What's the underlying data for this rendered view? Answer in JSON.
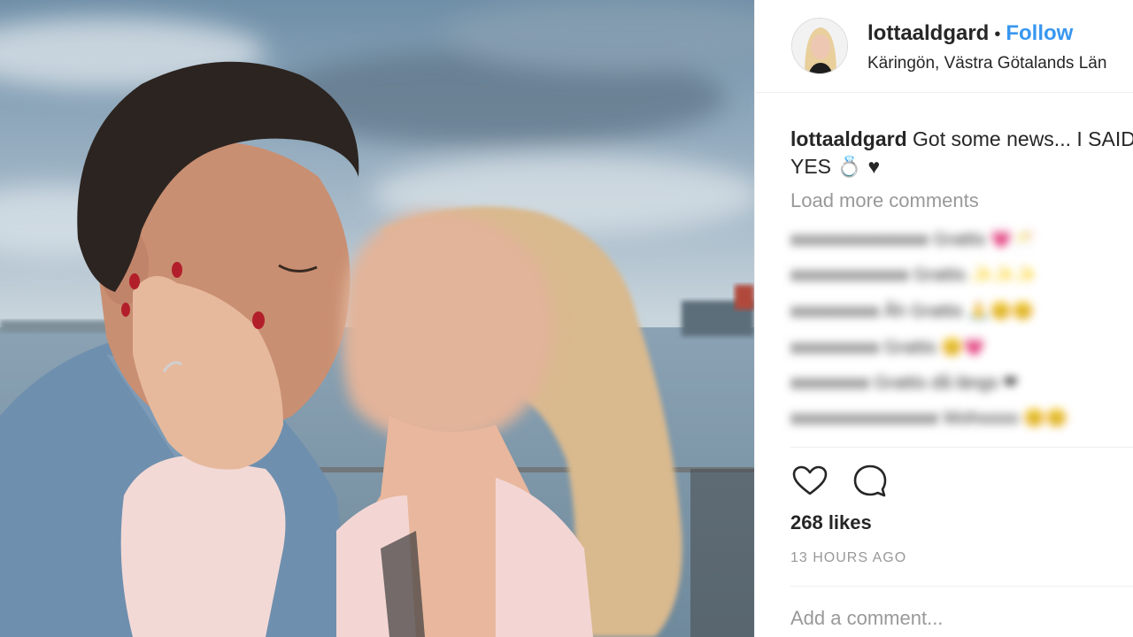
{
  "post": {
    "username": "lottaaldgard",
    "dot": "•",
    "follow_label": "Follow",
    "location": "Käringön, Västra Götalands Län",
    "caption_username": "lottaaldgard",
    "caption_text_line1": "Got some news... I SAID",
    "caption_text_line2": "YES 💍 ♥",
    "load_more_label": "Load more comments",
    "likes_label": "268 likes",
    "timestamp": "13 HOURS AGO",
    "add_comment_placeholder": "Add a comment..."
  },
  "blurred_comments": [
    {
      "user": "xxxxxxxxxxxxxx",
      "text": "Grattis 💗🥂"
    },
    {
      "user": "xxxxxxxxxxxx",
      "text": "Grattis ✨✨✨"
    },
    {
      "user": "xxxxxxxxx",
      "text": "Åh Grattis 🙏😊😊"
    },
    {
      "user": "xxxxxxxxx",
      "text": "Grattis 😊💗"
    },
    {
      "user": "xxxxxxxx",
      "text": "Grattis då längs ❤"
    },
    {
      "user": "xxxxxxxxxxxxxxx",
      "text": "Wohoooo 😊😊"
    }
  ],
  "icons": {
    "like": "heart-outline-icon",
    "comment": "comment-bubble-icon"
  },
  "colors": {
    "follow_blue": "#3897f0",
    "text": "#262626",
    "muted": "#999999",
    "divider": "#efefef"
  }
}
